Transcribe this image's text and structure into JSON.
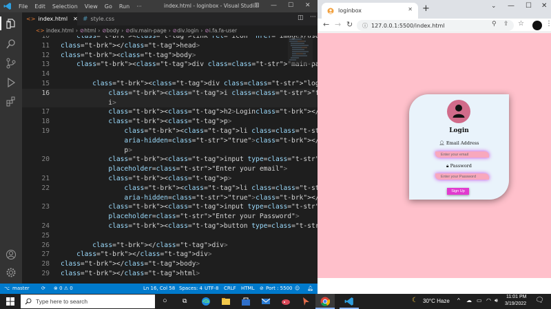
{
  "vscode": {
    "menus": [
      "File",
      "Edit",
      "Selection",
      "View",
      "Go",
      "Run",
      "···"
    ],
    "window_title": "index.html - loginbox - Visual Studi...",
    "tabs": [
      {
        "label": "index.html",
        "icon": "html-file-icon"
      },
      {
        "label": "style.css",
        "icon": "css-file-icon"
      }
    ],
    "breadcrumb": [
      "index.html",
      "html",
      "body",
      "div.main-page",
      "div.login",
      "i.fa.fa-user"
    ],
    "lines": [
      {
        "n": "10",
        "code": "    <link rel= icon  href= images/user.png  >"
      },
      {
        "n": "11",
        "code": "</head>"
      },
      {
        "n": "12",
        "code": "<body>"
      },
      {
        "n": "13",
        "code": "    <div class=\"main-page\">"
      },
      {
        "n": "14",
        "code": ""
      },
      {
        "n": "15",
        "code": "        <div class=\"login\">"
      },
      {
        "n": "16",
        "code": "            <i class=\"fa fa-user\" aria-hidden=\"true\"></"
      },
      {
        "n": "",
        "code": "            i>"
      },
      {
        "n": "17",
        "code": "            <h2>Login</h2>"
      },
      {
        "n": "18",
        "code": "            <p>"
      },
      {
        "n": "19",
        "code": "                <li class=\"fa fa-user\""
      },
      {
        "n": "",
        "code": "                aria-hidden=\"true\"></li>Email Address</"
      },
      {
        "n": "",
        "code": "                p>"
      },
      {
        "n": "20",
        "code": "            <input type=\"email\" name=\"email\""
      },
      {
        "n": "",
        "code": "            placeholder=\"Enter your email\">"
      },
      {
        "n": "21",
        "code": "            <p>"
      },
      {
        "n": "22",
        "code": "                <li class=\"fa fa-lock\""
      },
      {
        "n": "",
        "code": "                aria-hidden=\"true\"></li>Password</p>"
      },
      {
        "n": "23",
        "code": "            <input type=\"password\" name=\"password\""
      },
      {
        "n": "",
        "code": "            placeholder=\"Enter your Password\">"
      },
      {
        "n": "24",
        "code": "            <button type=\"submit\">Sign Up</button>"
      },
      {
        "n": "25",
        "code": ""
      },
      {
        "n": "26",
        "code": "        </div>"
      },
      {
        "n": "27",
        "code": "    </div>"
      },
      {
        "n": "28",
        "code": "</body>"
      },
      {
        "n": "29",
        "code": "</html>"
      }
    ],
    "status": {
      "branch": "master",
      "problems": "⊗ 0 ⚠ 0",
      "position": "Ln 16, Col 58",
      "spaces": "Spaces: 4",
      "encoding": "UTF-8",
      "eol": "CRLF",
      "language": "HTML",
      "port": "Port : 5500"
    }
  },
  "chrome": {
    "tab_title": "loginbox",
    "url": "127.0.0.1:5500/index.html",
    "page": {
      "heading": "Login",
      "email_label": "Email Address",
      "email_placeholder": "Enter your email",
      "password_label": "Password",
      "password_placeholder": "Enter your Password",
      "button": "Sign Up"
    }
  },
  "taskbar": {
    "search_placeholder": "Type here to search",
    "weather": "30°C  Haze",
    "time": "11:01 PM",
    "date": "3/19/2022"
  },
  "colors": {
    "page_bg": "#ffc0cb",
    "card_bg": "#e9f3fb",
    "avatar": "#d16b8a",
    "button": "#e13bcf",
    "vscode_status": "#007acc"
  }
}
